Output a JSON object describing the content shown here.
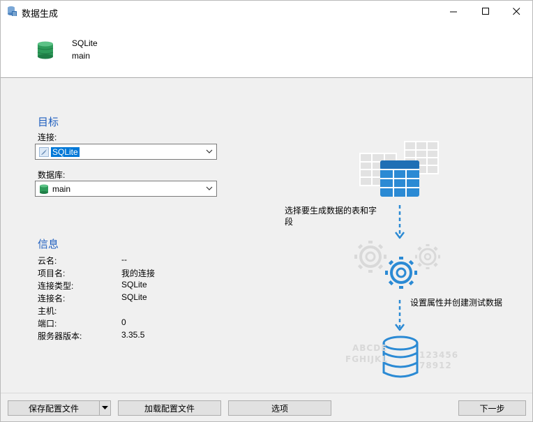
{
  "window": {
    "title": "数据生成",
    "minimize_glyph": "—",
    "maximize_glyph": "☐",
    "close_glyph": "✕"
  },
  "header": {
    "line1": "SQLite",
    "line2": "main",
    "icon": "database-icon"
  },
  "target": {
    "section_title": "目标",
    "connection_label": "连接:",
    "connection_value": "SQLite",
    "database_label": "数据库:",
    "database_value": "main"
  },
  "info": {
    "section_title": "信息",
    "rows": [
      {
        "label": "云名:",
        "value": "--"
      },
      {
        "label": "项目名:",
        "value": "我的连接"
      },
      {
        "label": "连接类型:",
        "value": "SQLite"
      },
      {
        "label": "连接名:",
        "value": "SQLite"
      },
      {
        "label": "主机:",
        "value": ""
      },
      {
        "label": "端口:",
        "value": "0"
      },
      {
        "label": "服务器版本:",
        "value": "3.35.5"
      }
    ]
  },
  "illustration": {
    "step1_caption_line1": "选择要生成数据的表和字",
    "step1_caption_line2": "段",
    "step2_caption": "设置属性并创建测试数据",
    "deco_left_1": "ABCDE",
    "deco_left_2": "FGHIJKL",
    "deco_right_1": "123456",
    "deco_right_2": "78912",
    "accent_color": "#2b8ad4"
  },
  "buttons": {
    "save_config": "保存配置文件",
    "load_config": "加载配置文件",
    "options": "选项",
    "next": "下一步"
  }
}
